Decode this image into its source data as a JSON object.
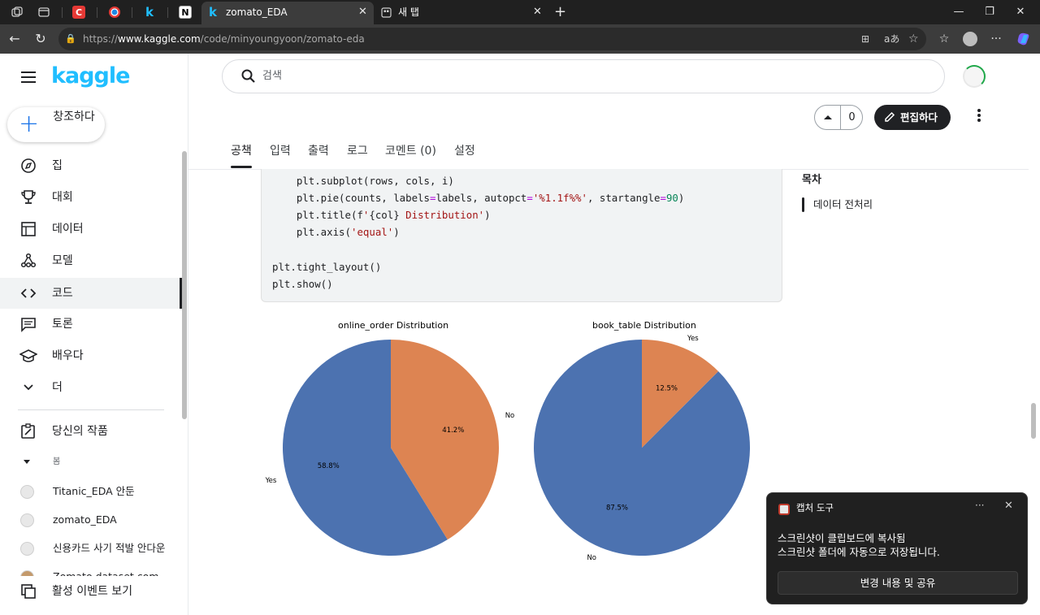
{
  "browser": {
    "tabs": [
      {
        "icon": "workspaces-icon"
      },
      {
        "icon": "tab-actions-icon"
      },
      {
        "icon": "c-app-icon"
      },
      {
        "icon": "chrome-like-icon"
      },
      {
        "icon": "kaggle-k-icon"
      },
      {
        "icon": "notion-icon"
      },
      {
        "title": "zomato_EDA",
        "icon": "kaggle-k-icon",
        "active": true
      },
      {
        "title": "새 탭",
        "icon": "new-tab-page-icon"
      }
    ],
    "url_prefix": "https://",
    "url_domain": "www.kaggle.com",
    "url_path": "/code/minyoungyoon/zomato-eda",
    "colors": {
      "tabbar": "#202020",
      "addressbar": "#3c3c3c"
    }
  },
  "kaggle": {
    "logo": "kaggle",
    "create_label": "창조하다",
    "nav": [
      {
        "label": "집",
        "icon": "compass-icon"
      },
      {
        "label": "대회",
        "icon": "trophy-icon"
      },
      {
        "label": "데이터",
        "icon": "table-icon"
      },
      {
        "label": "모델",
        "icon": "models-icon"
      },
      {
        "label": "코드",
        "icon": "code-icon",
        "active": true
      },
      {
        "label": "토론",
        "icon": "discussion-icon"
      },
      {
        "label": "배우다",
        "icon": "learn-cap-icon"
      },
      {
        "label": "더",
        "icon": "chevron-down-icon"
      }
    ],
    "your_work_label": "당신의 작품",
    "viewed_label": "봄",
    "recent": [
      "Titanic_EDA 안둔",
      "zomato_EDA",
      "신용카드 사기 적발 안다운",
      "Zomato dataset com"
    ],
    "events_label": "활성 이벤트 보기",
    "search_placeholder": "검색",
    "vote_count": "0",
    "edit_label": "편집하다",
    "tabs": [
      "공책",
      "입력",
      "출력",
      "로그",
      "코멘트 (0)",
      "설정"
    ],
    "toc_title": "목차",
    "toc_items": [
      "데이터 전처리"
    ],
    "brand_color": "#20beff"
  },
  "code_lines": [
    {
      "indent": "    ",
      "parts": [
        {
          "t": "plt.subplot(rows, cols, i)",
          "c": ""
        }
      ]
    },
    {
      "indent": "    ",
      "parts": [
        {
          "t": "plt.pie(counts, labels",
          "c": ""
        },
        {
          "t": "=",
          "c": "op"
        },
        {
          "t": "labels, autopct",
          "c": ""
        },
        {
          "t": "=",
          "c": "op"
        },
        {
          "t": "'%1.1f%%'",
          "c": "str"
        },
        {
          "t": ", startangle",
          "c": ""
        },
        {
          "t": "=",
          "c": "op"
        },
        {
          "t": "90",
          "c": "num"
        },
        {
          "t": ")",
          "c": ""
        }
      ]
    },
    {
      "indent": "    ",
      "parts": [
        {
          "t": "plt.title(f",
          "c": ""
        },
        {
          "t": "'",
          "c": "str"
        },
        {
          "t": "{col}",
          "c": ""
        },
        {
          "t": " Distribution'",
          "c": "str"
        },
        {
          "t": ")",
          "c": ""
        }
      ]
    },
    {
      "indent": "    ",
      "parts": [
        {
          "t": "plt.axis(",
          "c": ""
        },
        {
          "t": "'equal'",
          "c": "str"
        },
        {
          "t": ")",
          "c": ""
        }
      ]
    },
    {
      "indent": "",
      "parts": [
        {
          "t": "",
          "c": ""
        }
      ]
    },
    {
      "indent": "",
      "parts": [
        {
          "t": "plt.tight_layout()",
          "c": ""
        }
      ]
    },
    {
      "indent": "",
      "parts": [
        {
          "t": "plt.show()",
          "c": ""
        }
      ]
    }
  ],
  "chart_data": [
    {
      "type": "pie",
      "title": "online_order Distribution",
      "labels": [
        "Yes",
        "No"
      ],
      "values": [
        58.8,
        41.2
      ],
      "percent_labels": [
        "58.8%",
        "41.2%"
      ],
      "colors": [
        "#4c72b0",
        "#dd8452"
      ],
      "startangle": 90
    },
    {
      "type": "pie",
      "title": "book_table Distribution",
      "labels": [
        "No",
        "Yes"
      ],
      "values": [
        87.5,
        12.5
      ],
      "percent_labels": [
        "87.5%",
        "12.5%"
      ],
      "colors": [
        "#4c72b0",
        "#dd8452"
      ],
      "startangle": 90
    }
  ],
  "toast": {
    "app": "캡처 도구",
    "line1": "스크린샷이 클립보드에 복사됨",
    "line2": "스크린샷 폴더에 자동으로 저장됩니다.",
    "button": "변경 내용 및 공유",
    "more": "···",
    "close": "✕"
  }
}
